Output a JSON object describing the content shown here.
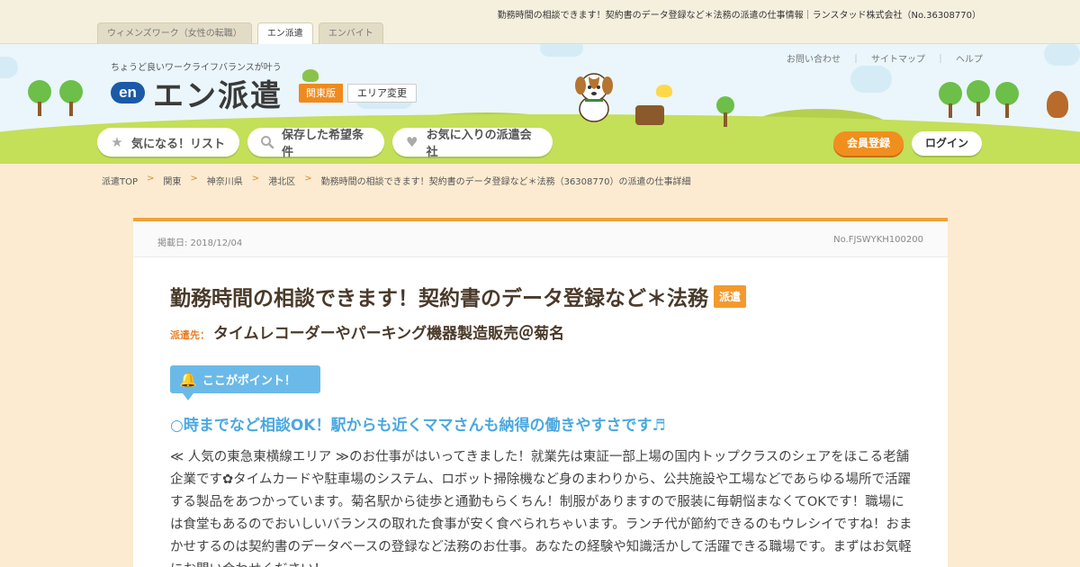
{
  "top": {
    "page_title": "勤務時間の相談できます！契約書のデータ登録など＊法務の派遣の仕事情報｜ランスタッド株式会社（No.36308770）",
    "site_tabs": [
      {
        "label": "ウィメンズワーク（女性の転職）",
        "active": false
      },
      {
        "label": "エン派遣",
        "active": true
      },
      {
        "label": "エンバイト",
        "active": false
      }
    ]
  },
  "header": {
    "tagline": "ちょうど良いワークライフバランスが叶う",
    "logo_mark": "en",
    "logo_text": "エン派遣",
    "region_badge": "関東版",
    "area_change": "エリア変更",
    "util_links": [
      "お問い合わせ",
      "サイトマップ",
      "ヘルプ"
    ],
    "util_sep": "｜",
    "nav": [
      {
        "label": "気になる！リスト",
        "icon": "star-icon"
      },
      {
        "label": "保存した希望条件",
        "icon": "search-icon"
      },
      {
        "label": "お気に入りの派遣会社",
        "icon": "heart-icon"
      }
    ],
    "register": "会員登録",
    "login": "ログイン"
  },
  "breadcrumb": {
    "items": [
      "派遣TOP",
      "関東",
      "神奈川県",
      "港北区",
      "勤務時間の相談できます！契約書のデータ登録など＊法務（36308770）の派遣の仕事詳細"
    ],
    "sep": ">"
  },
  "job": {
    "posted": "掲載日: 2018/12/04",
    "number": "No.FJSWYKH100200",
    "title": "勤務時間の相談できます！契約書のデータ登録など＊法務",
    "tag": "派遣",
    "dest_label": "派遣先：",
    "dest_value": "タイムレコーダーやパーキング機器製造販売＠菊名",
    "point_label": "ここがポイント！",
    "catch": "○時までなど相談OK！駅からも近くママさんも納得の働きやすさです♬",
    "body": "≪ 人気の東急東横線エリア ≫のお仕事がはいってきました！就業先は東証一部上場の国内トップクラスのシェアをほこる老舗企業です✿タイムカードや駐車場のシステム、ロボット掃除機など身のまわりから、公共施設や工場などであらゆる場所で活躍する製品をあつかっています。菊名駅から徒歩と通勤もらくちん！制服がありますので服装に毎朝悩まなくてOKです！職場には食堂もあるのでおいしいバランスの取れた食事が安く食べられちゃいます。ランチ代が節約できるのもウレシイですね！おまかせするのは契約書のデータベースの登録など法務のお仕事。あなたの経験や知識活かして活躍できる職場です。まずはお気軽にお問い合わせください！"
  },
  "colors": {
    "accent": "#f08f1e",
    "point": "#6bb9e8",
    "catch": "#4aa8e0",
    "background": "#fcebd1"
  }
}
